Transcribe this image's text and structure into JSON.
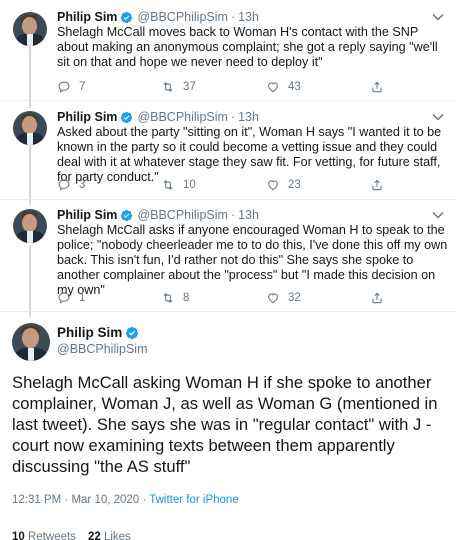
{
  "author": {
    "name": "Philip Sim",
    "handle": "@BBCPhilipSim"
  },
  "colors": {
    "verified": "#1da1f2",
    "link": "#1b95e0",
    "muted": "#657786"
  },
  "replies": [
    {
      "time": "13h",
      "text": "Shelagh McCall moves back to Woman H's contact with the SNP about making an anonymous complaint; she got a reply saying \"we'll sit on that and hope we never need to deploy it\"",
      "reply_count": "7",
      "retweet_count": "37",
      "like_count": "43"
    },
    {
      "time": "13h",
      "text": "Asked about the party \"sitting on it\", Woman H says \"I wanted it to be known in the party so it could become a vetting issue and they could deal with it at whatever stage they saw fit. For vetting, for future staff, for party conduct.\"",
      "reply_count": "3",
      "retweet_count": "10",
      "like_count": "23"
    },
    {
      "time": "13h",
      "text": "Shelagh McCall asks if anyone encouraged Woman H to speak to the police; \"nobody cheerleader me to to do this, I've done this off my own back. This isn't fun, I'd rather not do this\" She says she spoke to another complainer about the \"process\" but \"I made this decision on my own\"",
      "reply_count": "1",
      "retweet_count": "8",
      "like_count": "32"
    }
  ],
  "main_tweet": {
    "text": "Shelagh McCall asking Woman H if she spoke to another complainer, Woman J, as well as Woman G (mentioned in last tweet). She says she was in \"regular contact\" with J - court now examining texts between them apparently discussing \"the AS stuff\"",
    "timestamp": "12:31 PM · Mar 10, 2020 ·",
    "source": "Twitter for iPhone",
    "retweets_count": "10",
    "retweets_label": "Retweets",
    "likes_count": "22",
    "likes_label": "Likes"
  }
}
